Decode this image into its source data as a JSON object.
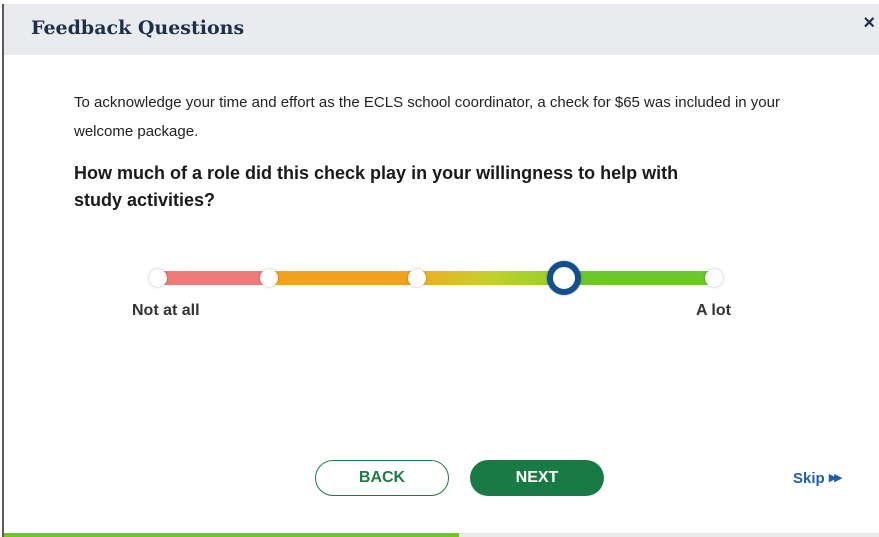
{
  "header": {
    "title": "Feedback Questions",
    "close_label": "×"
  },
  "content": {
    "intro": "To acknowledge your time and effort as the ECLS school coordinator, a check for $65 was included in your welcome package.",
    "question": "How much of a role did this check play in your willingness to help with study activities?"
  },
  "scale": {
    "min_label": "Not at all",
    "max_label": "A lot",
    "point_count": 5,
    "selected_index": 4,
    "segment_colors": [
      "#ee7a7a",
      "#f2a21e",
      "#c3d12a",
      "#6cc72a"
    ],
    "selected_ring_color": "#134f8f"
  },
  "nav": {
    "back_label": "BACK",
    "next_label": "NEXT",
    "skip_label": "Skip",
    "skip_icon": "fast-forward-icon"
  },
  "progress": {
    "fraction": 0.52,
    "color": "#6cc72a"
  },
  "colors": {
    "primary_green": "#1a7a43",
    "link_blue": "#1f5fa8",
    "header_bg": "#e9ebee",
    "header_text": "#1e3049"
  }
}
